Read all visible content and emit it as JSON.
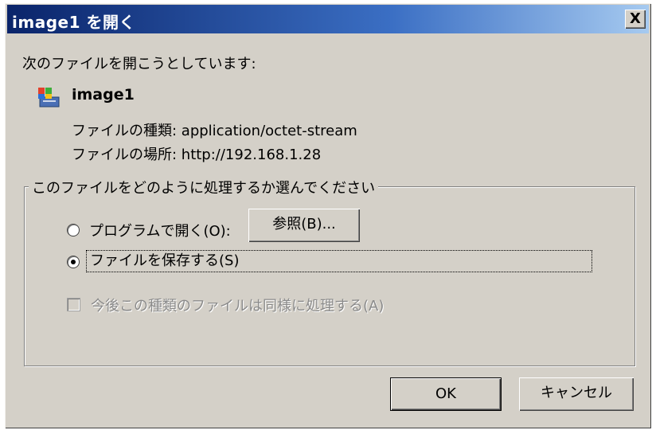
{
  "window": {
    "title": "image1 を開く",
    "close_label": "X"
  },
  "prompt": {
    "heading": "次のファイルを開こうとしています:",
    "file_name": "image1",
    "type_row": "ファイルの種類: application/octet-stream",
    "location_row": "ファイルの場所: http://192.168.1.28"
  },
  "group": {
    "legend": "このファイルをどのように処理するか選んでください",
    "open_with_label": "プログラムで開く(O):",
    "browse_label": "参照(B)...",
    "save_label": "ファイルを保存する(S)",
    "save_selected": true,
    "remember_label": "今後この種類のファイルは同様に処理する(A)",
    "remember_checked": false
  },
  "buttons": {
    "ok": "OK",
    "cancel": "キャンセル"
  },
  "icons": {
    "file": "windows-file-icon",
    "close": "close-icon"
  }
}
